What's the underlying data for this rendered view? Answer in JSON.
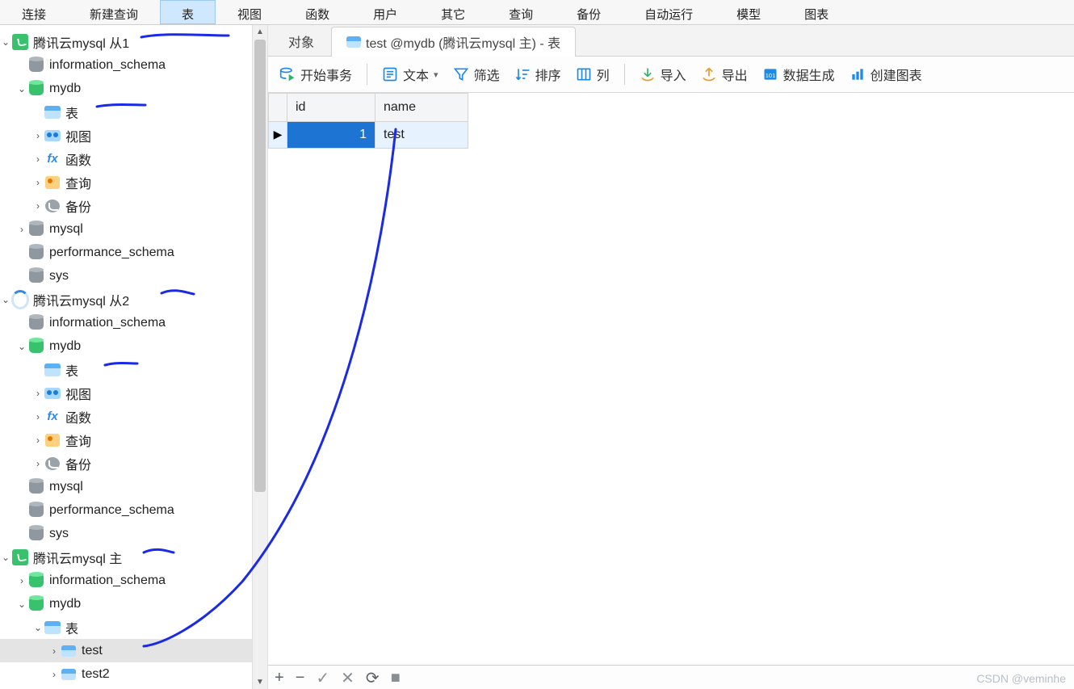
{
  "menubar": {
    "items": [
      {
        "label": "连接"
      },
      {
        "label": "新建查询"
      },
      {
        "label": "表",
        "active": true
      },
      {
        "label": "视图"
      },
      {
        "label": "函数"
      },
      {
        "label": "用户"
      },
      {
        "label": "其它"
      },
      {
        "label": "查询"
      },
      {
        "label": "备份"
      },
      {
        "label": "自动运行"
      },
      {
        "label": "模型"
      },
      {
        "label": "图表"
      }
    ]
  },
  "tree": {
    "nodes": [
      {
        "depth": 0,
        "arrow": "down",
        "icon": "conn",
        "label": "腾讯云mysql 从1",
        "annot": true
      },
      {
        "depth": 1,
        "arrow": "none",
        "icon": "db",
        "label": "information_schema"
      },
      {
        "depth": 1,
        "arrow": "down",
        "icon": "db-green",
        "label": "mydb"
      },
      {
        "depth": 2,
        "arrow": "none",
        "icon": "table",
        "label": "表",
        "annot": true
      },
      {
        "depth": 2,
        "arrow": "right",
        "icon": "view",
        "label": "视图"
      },
      {
        "depth": 2,
        "arrow": "right",
        "icon": "fx",
        "label": "函数"
      },
      {
        "depth": 2,
        "arrow": "right",
        "icon": "query",
        "label": "查询"
      },
      {
        "depth": 2,
        "arrow": "right",
        "icon": "backup",
        "label": "备份"
      },
      {
        "depth": 1,
        "arrow": "right",
        "icon": "db",
        "label": "mysql"
      },
      {
        "depth": 1,
        "arrow": "none",
        "icon": "db",
        "label": "performance_schema"
      },
      {
        "depth": 1,
        "arrow": "none",
        "icon": "db",
        "label": "sys"
      },
      {
        "depth": 0,
        "arrow": "down",
        "icon": "conn-loading",
        "label": "腾讯云mysql 从2",
        "annot": true
      },
      {
        "depth": 1,
        "arrow": "none",
        "icon": "db",
        "label": "information_schema"
      },
      {
        "depth": 1,
        "arrow": "down",
        "icon": "db-green",
        "label": "mydb"
      },
      {
        "depth": 2,
        "arrow": "none",
        "icon": "table",
        "label": "表",
        "annot": true
      },
      {
        "depth": 2,
        "arrow": "right",
        "icon": "view",
        "label": "视图"
      },
      {
        "depth": 2,
        "arrow": "right",
        "icon": "fx",
        "label": "函数"
      },
      {
        "depth": 2,
        "arrow": "right",
        "icon": "query",
        "label": "查询"
      },
      {
        "depth": 2,
        "arrow": "right",
        "icon": "backup",
        "label": "备份"
      },
      {
        "depth": 1,
        "arrow": "none",
        "icon": "db",
        "label": "mysql"
      },
      {
        "depth": 1,
        "arrow": "none",
        "icon": "db",
        "label": "performance_schema"
      },
      {
        "depth": 1,
        "arrow": "none",
        "icon": "db",
        "label": "sys"
      },
      {
        "depth": 0,
        "arrow": "down",
        "icon": "conn",
        "label": "腾讯云mysql 主",
        "annot": true
      },
      {
        "depth": 1,
        "arrow": "right",
        "icon": "db-green",
        "label": "information_schema"
      },
      {
        "depth": 1,
        "arrow": "down",
        "icon": "db-green",
        "label": "mydb"
      },
      {
        "depth": 2,
        "arrow": "down",
        "icon": "table",
        "label": "表"
      },
      {
        "depth": 3,
        "arrow": "right",
        "icon": "table-small",
        "label": "test",
        "selected": true,
        "annot": true
      },
      {
        "depth": 3,
        "arrow": "right",
        "icon": "table-small",
        "label": "test2"
      }
    ]
  },
  "tabs": {
    "items": [
      {
        "label": "对象",
        "active": false
      },
      {
        "label": "test @mydb (腾讯云mysql 主) - 表",
        "active": true,
        "icon": "table"
      }
    ]
  },
  "toolbar": {
    "begin": "开始事务",
    "text": "文本",
    "filter": "筛选",
    "sort": "排序",
    "columns": "列",
    "import": "导入",
    "export": "导出",
    "datagen": "数据生成",
    "chart": "创建图表"
  },
  "grid": {
    "headers": [
      "id",
      "name"
    ],
    "rows": [
      {
        "id": "1",
        "name": "test",
        "current": true
      }
    ]
  },
  "statusbar": {
    "add": "+",
    "del": "−",
    "ok": "✓",
    "cancel": "✕",
    "refresh": "⟳",
    "stop": "■"
  },
  "watermark": "CSDN @veminhe"
}
